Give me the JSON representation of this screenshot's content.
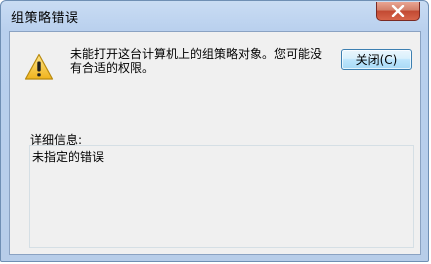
{
  "window": {
    "title": "组策略错误"
  },
  "titlebar": {
    "close_icon": "close-x-icon"
  },
  "dialog": {
    "icon": "warning-icon",
    "message": "未能打开这台计算机上的组策略对象。您可能没有合适的权限。",
    "close_button_label": "关闭(C)",
    "details_label": "详细信息:",
    "details_text": "未指定的错误"
  },
  "colors": {
    "warning_fill": "#f7c934",
    "title_close_red": "#c24a33",
    "client_bg": "#f0f0f0",
    "frame_blue": "#b9d0ee"
  }
}
